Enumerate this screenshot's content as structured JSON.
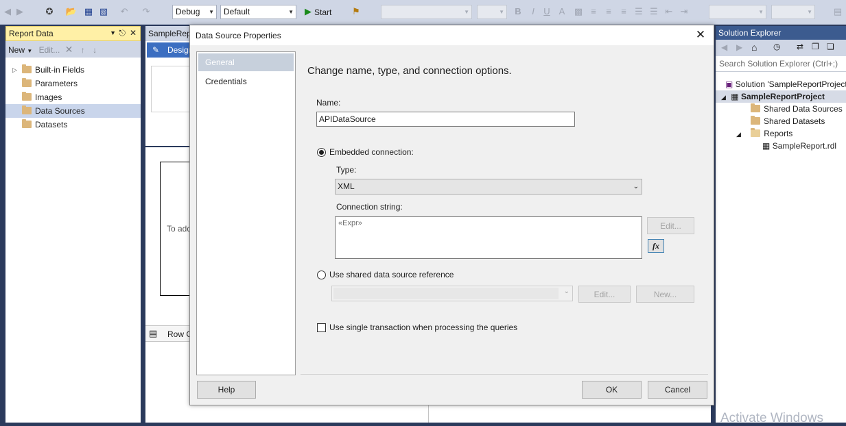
{
  "toolbar": {
    "config": "Debug",
    "platform": "Default",
    "start": "Start"
  },
  "report_data": {
    "title": "Report Data",
    "new_label": "New",
    "edit_label": "Edit...",
    "items": [
      {
        "label": "Built-in Fields"
      },
      {
        "label": "Parameters"
      },
      {
        "label": "Images"
      },
      {
        "label": "Data Sources"
      },
      {
        "label": "Datasets"
      }
    ]
  },
  "designer": {
    "tab": "SampleRep",
    "design_label": "Design",
    "hint": "To add",
    "row_groups": "Row G"
  },
  "solution": {
    "title": "Solution Explorer",
    "search_placeholder": "Search Solution Explorer (Ctrl+;)",
    "items": [
      {
        "label": "Solution 'SampleReportProject"
      },
      {
        "label": "SampleReportProject"
      },
      {
        "label": "Shared Data Sources"
      },
      {
        "label": "Shared Datasets"
      },
      {
        "label": "Reports"
      },
      {
        "label": "SampleReport.rdl"
      }
    ]
  },
  "dialog": {
    "title": "Data Source Properties",
    "nav": [
      {
        "label": "General"
      },
      {
        "label": "Credentials"
      }
    ],
    "heading": "Change name, type, and connection options.",
    "name_label": "Name:",
    "name_value": "APIDataSource",
    "embedded_label": "Embedded connection:",
    "type_label": "Type:",
    "type_value": "XML",
    "conn_label": "Connection string:",
    "conn_value": "«Expr»",
    "edit_label": "Edit...",
    "new_label": "New...",
    "fx_label": "fx",
    "shared_label": "Use shared data source reference",
    "single_tx_label": "Use single transaction when processing the queries",
    "help_label": "Help",
    "ok_label": "OK",
    "cancel_label": "Cancel"
  },
  "watermark": "Activate Windows"
}
